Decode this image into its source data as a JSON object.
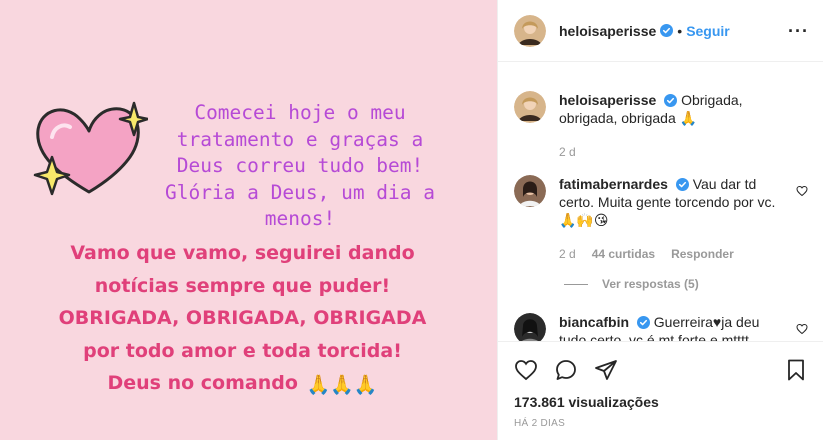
{
  "story": {
    "mono_lines": [
      "Comecei hoje o meu",
      "tratamento e graças a",
      "Deus correu tudo bem!",
      "Glória a Deus, um dia a",
      "menos!"
    ],
    "bold_lines": [
      "Vamo que vamo, seguirei dando",
      "notícias sempre que puder!",
      "OBRIGADA, OBRIGADA, OBRIGADA",
      "por todo amor e toda torcida!",
      "Deus no comando"
    ],
    "bold_emoji": "🙏🙏🙏",
    "sticker_icon": "sparkle-heart-icon"
  },
  "header": {
    "username": "heloisaperisse",
    "separator": "•",
    "follow_label": "Seguir",
    "more_label": "···"
  },
  "comments": [
    {
      "username": "heloisaperisse",
      "text": "Obrigada, obrigada, obrigada 🙏",
      "time": "2 d"
    },
    {
      "username": "fatimabernardes",
      "text": "Vau dar td certo. Muita gente torcendo por vc. 🙏🙌😘",
      "time": "2 d",
      "likes": "44 curtidas",
      "reply_label": "Responder",
      "view_replies": "Ver respostas (5)"
    },
    {
      "username": "biancafbin",
      "text": "Guerreira♥ja deu tudo certo, vc é mt forte e mtttt amada. Estamos contigo nessa"
    }
  ],
  "actions": {
    "views": "173.861 visualizações",
    "timestamp": "HÁ 2 DIAS"
  },
  "colors": {
    "background_pink": "#f9d7df",
    "mono_text_purple": "#b64ad6",
    "bold_text_pink": "#e0407a",
    "link_blue": "#3897f0",
    "meta_gray": "#999999"
  }
}
